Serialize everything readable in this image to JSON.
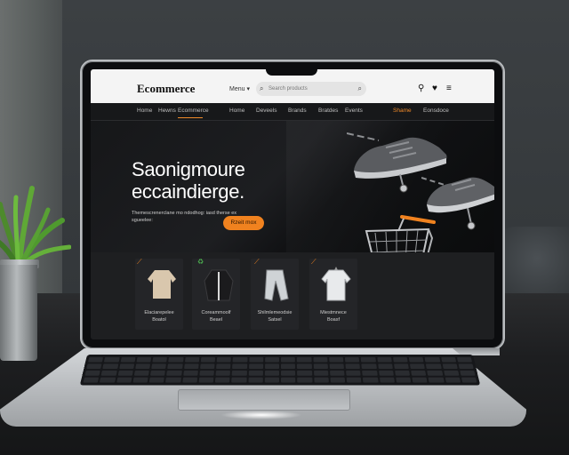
{
  "site": {
    "logo": "Ecommerce",
    "menu_label": "Menu ▾",
    "search_placeholder": "Search products",
    "nav": [
      "Home",
      "Hewns",
      "Ecommerce",
      "Home",
      "Deveels",
      "Brands",
      "Bratdes",
      "Events",
      "Shame",
      "Eonsdoce"
    ],
    "hero": {
      "title_line1": "Saonigmoure",
      "title_line2": "eccaindierge.",
      "subtitle": "Themescrenerclane mo ndodhog: iasd therse ex sgueelee:",
      "button": "Rzeit mox"
    },
    "products": [
      {
        "name_line1": "Elaciarepelee",
        "name_line2": "Boatol"
      },
      {
        "name_line1": "Coreammoolf",
        "name_line2": "Beael"
      },
      {
        "name_line1": "Shilmlemeodsie",
        "name_line2": "Satsel"
      },
      {
        "name_line1": "Miestmnece",
        "name_line2": "Boasf"
      }
    ]
  },
  "colors": {
    "accent": "#f0821f",
    "header_bg": "#f4f4f4",
    "screen_bg": "#111214"
  },
  "icons": [
    "search-icon",
    "user-icon",
    "heart-icon",
    "hamburger-icon",
    "shopping-cart-icon",
    "sneaker-icon"
  ]
}
